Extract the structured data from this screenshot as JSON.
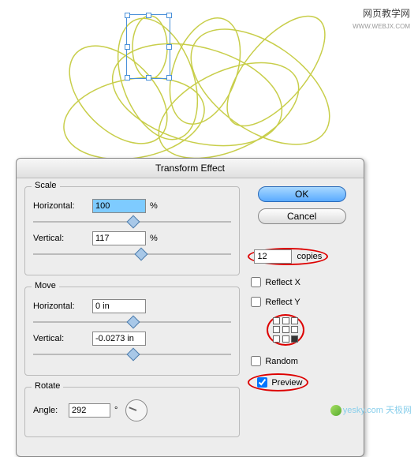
{
  "watermark1": {
    "main": "网页教学网",
    "sub": "WWW.WEBJX.COM"
  },
  "watermark2": {
    "text": "yesky.com 天极网"
  },
  "dialog": {
    "title": "Transform Effect",
    "scale": {
      "legend": "Scale",
      "horizontal_label": "Horizontal:",
      "horizontal_value": "100",
      "horizontal_unit": "%",
      "vertical_label": "Vertical:",
      "vertical_value": "117",
      "vertical_unit": "%"
    },
    "move": {
      "legend": "Move",
      "horizontal_label": "Horizontal:",
      "horizontal_value": "0 in",
      "vertical_label": "Vertical:",
      "vertical_value": "-0.0273 in"
    },
    "rotate": {
      "legend": "Rotate",
      "angle_label": "Angle:",
      "angle_value": "292",
      "angle_unit": "°"
    },
    "buttons": {
      "ok": "OK",
      "cancel": "Cancel"
    },
    "copies": {
      "value": "12",
      "label": "copies"
    },
    "options": {
      "reflect_x": "Reflect X",
      "reflect_y": "Reflect Y",
      "random": "Random",
      "preview": "Preview",
      "preview_checked": true
    }
  },
  "chart_data": null
}
